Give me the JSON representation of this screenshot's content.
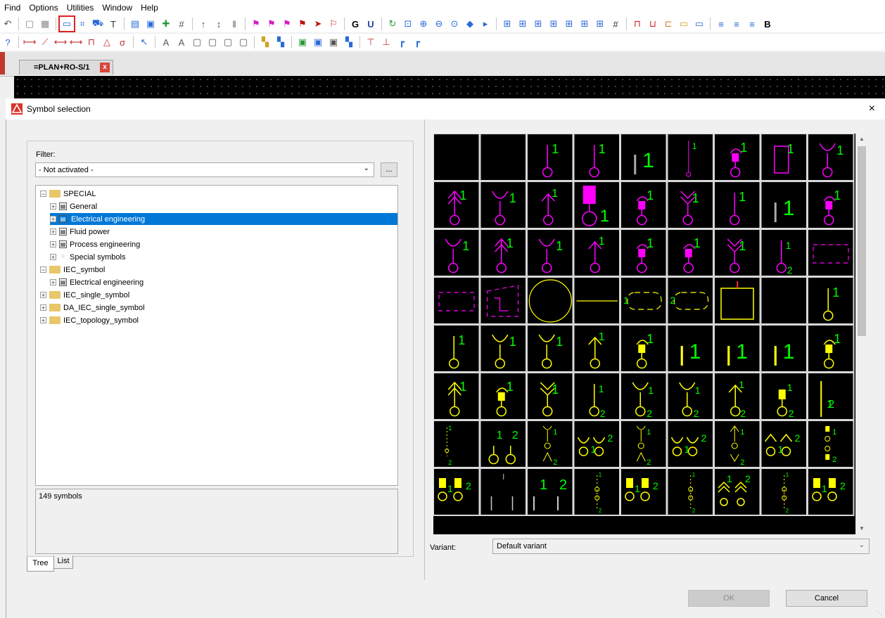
{
  "menu": [
    "Find",
    "Options",
    "Utilities",
    "Window",
    "Help"
  ],
  "toolbar_row1_icons": [
    "undo-icon",
    "page-icon",
    "table-icon",
    "insert-symbol-icon",
    "macro-icon",
    "cart-icon",
    "text-icon",
    "navigator-icon",
    "window-icon",
    "puzzle-icon",
    "numbering-icon",
    "number-up-icon",
    "number-sort-icon",
    "bar-icon",
    "flag-magenta-icon",
    "flag-purple-icon",
    "flag-pink-icon",
    "flag-red-icon",
    "arrow-red-icon",
    "flag-x-icon",
    "g-icon",
    "u-icon",
    "refresh-icon",
    "zoom-window-icon",
    "zoom-in-icon",
    "zoom-out-icon",
    "zoom-fit-icon",
    "back-icon",
    "forward-icon",
    "grid-a-icon",
    "grid-b-icon",
    "grid-c-icon",
    "grid-d-icon",
    "grid-e-icon",
    "grid-f-icon",
    "grid-g-icon",
    "grid-h-icon",
    "cable-icon",
    "cable2-icon",
    "plug-icon",
    "device-icon",
    "box-icon",
    "format-a-icon",
    "format-b-icon",
    "format-c-icon",
    "bold-icon"
  ],
  "toolbar_row2_icons": [
    "help-icon",
    "line-icon",
    "pen-icon",
    "dim-icon",
    "dim2-icon",
    "rect-icon",
    "polygon-icon",
    "arc-icon",
    "pointer-icon",
    "text-a-icon",
    "text-b-icon",
    "rect-a-icon",
    "rect-b-icon",
    "rect-c-icon",
    "rect-d-icon",
    "layer-a-icon",
    "layer-b-icon",
    "layer-c-icon",
    "layer-d-icon",
    "layer-e-icon",
    "layer-f-icon",
    "cross-icon",
    "cross2-icon",
    "corner-icon",
    "corner2-icon"
  ],
  "doc_tab": {
    "label": "=PLAN+RO-S/1",
    "close": "x"
  },
  "dialog": {
    "title": "Symbol selection",
    "close": "×"
  },
  "filter": {
    "label": "Filter:",
    "value": "- Not activated -",
    "button": "..."
  },
  "tree": [
    {
      "label": "SPECIAL",
      "level": 0,
      "expander": "⊟",
      "icon": "folder"
    },
    {
      "label": "General",
      "level": 1,
      "expander": "⊞",
      "icon": "group"
    },
    {
      "label": "Electrical engineering",
      "level": 1,
      "expander": "⊞",
      "icon": "group",
      "selected": true
    },
    {
      "label": "Fluid power",
      "level": 1,
      "expander": "⊞",
      "icon": "group"
    },
    {
      "label": "Process engineering",
      "level": 1,
      "expander": "⊞",
      "icon": "group"
    },
    {
      "label": "Special symbols",
      "level": 1,
      "expander": "⊞",
      "icon": "special"
    },
    {
      "label": "IEC_symbol",
      "level": 0,
      "expander": "⊟",
      "icon": "folder"
    },
    {
      "label": "Electrical engineering",
      "level": 1,
      "expander": "⊞",
      "icon": "group"
    },
    {
      "label": "IEC_single_symbol",
      "level": 0,
      "expander": "⊞",
      "icon": "folder"
    },
    {
      "label": "DA_IEC_single_symbol",
      "level": 0,
      "expander": "⊞",
      "icon": "folder"
    },
    {
      "label": "IEC_topology_symbol",
      "level": 0,
      "expander": "⊞",
      "icon": "folder"
    }
  ],
  "symbol_count": "149 symbols",
  "bottom_tabs": {
    "tree": "Tree",
    "list": "List"
  },
  "variant": {
    "label": "Variant:",
    "value": "Default variant"
  },
  "buttons": {
    "ok": "OK",
    "cancel": "Cancel"
  },
  "colors": {
    "magenta": "#ff00ff",
    "yellow": "#ffff00",
    "green": "#00ff00",
    "selection": "#0078d7"
  },
  "symbol_grid": [
    [
      {
        "c": "blank"
      },
      {
        "c": "blank"
      },
      {
        "c": "m",
        "t": "pin",
        "n": [
          "1"
        ]
      },
      {
        "c": "m",
        "t": "pin",
        "n": [
          "1"
        ]
      },
      {
        "c": "m",
        "t": "bar",
        "n": [
          "1"
        ]
      },
      {
        "c": "m",
        "t": "thin",
        "n": [
          "1"
        ]
      },
      {
        "c": "m",
        "t": "plug",
        "n": [
          "1"
        ]
      },
      {
        "c": "m",
        "t": "box",
        "n": [
          "1"
        ]
      },
      {
        "c": "m",
        "t": "fork",
        "n": [
          "1"
        ]
      }
    ],
    [
      {
        "c": "m",
        "t": "dblarrow",
        "n": [
          "1"
        ]
      },
      {
        "c": "m",
        "t": "fork",
        "n": [
          "1"
        ]
      },
      {
        "c": "m",
        "t": "arrow",
        "n": [
          "1"
        ]
      },
      {
        "c": "m",
        "t": "bigplug",
        "n": [
          "1"
        ]
      },
      {
        "c": "m",
        "t": "plug",
        "n": [
          "1"
        ]
      },
      {
        "c": "m",
        "t": "vfork",
        "n": [
          "1"
        ]
      },
      {
        "c": "m",
        "t": "pin",
        "n": [
          "1"
        ]
      },
      {
        "c": "m",
        "t": "bar",
        "n": [
          "1"
        ]
      },
      {
        "c": "m",
        "t": "plug",
        "n": [
          "1"
        ]
      }
    ],
    [
      {
        "c": "m",
        "t": "fork",
        "n": [
          "1"
        ]
      },
      {
        "c": "m",
        "t": "dblarrow",
        "n": [
          "1"
        ]
      },
      {
        "c": "m",
        "t": "fork",
        "n": [
          "1"
        ]
      },
      {
        "c": "m",
        "t": "arrow",
        "n": [
          "1"
        ]
      },
      {
        "c": "m",
        "t": "plug",
        "n": [
          "1"
        ]
      },
      {
        "c": "m",
        "t": "plug",
        "n": [
          "1"
        ]
      },
      {
        "c": "m",
        "t": "vfork",
        "n": [
          "1"
        ]
      },
      {
        "c": "m",
        "t": "pin2",
        "n": [
          "1",
          "2"
        ]
      },
      {
        "c": "m",
        "t": "dashbox",
        "n": []
      }
    ],
    [
      {
        "c": "m",
        "t": "dashbox",
        "n": []
      },
      {
        "c": "m",
        "t": "dashbox2",
        "n": []
      },
      {
        "c": "y",
        "t": "circle",
        "n": []
      },
      {
        "c": "y",
        "t": "hline",
        "n": []
      },
      {
        "c": "y",
        "t": "dashround",
        "n": [
          "1"
        ]
      },
      {
        "c": "y",
        "t": "dashround",
        "n": [
          "2"
        ]
      },
      {
        "c": "y",
        "t": "square",
        "n": []
      },
      {
        "c": "blank"
      },
      {
        "c": "y",
        "t": "pin",
        "n": [
          "1"
        ]
      }
    ],
    [
      {
        "c": "y",
        "t": "pin",
        "n": [
          "1"
        ]
      },
      {
        "c": "y",
        "t": "fork",
        "n": [
          "1"
        ]
      },
      {
        "c": "y",
        "t": "fork",
        "n": [
          "1"
        ]
      },
      {
        "c": "y",
        "t": "arrow",
        "n": [
          "1"
        ]
      },
      {
        "c": "y",
        "t": "plug",
        "n": [
          "1"
        ]
      },
      {
        "c": "y",
        "t": "bar",
        "n": [
          "1"
        ]
      },
      {
        "c": "y",
        "t": "bar",
        "n": [
          "1"
        ]
      },
      {
        "c": "y",
        "t": "bar",
        "n": [
          "1"
        ]
      },
      {
        "c": "y",
        "t": "plug",
        "n": [
          "1"
        ]
      }
    ],
    [
      {
        "c": "y",
        "t": "dblarrow",
        "n": [
          "1"
        ]
      },
      {
        "c": "y",
        "t": "plug",
        "n": [
          "1"
        ]
      },
      {
        "c": "y",
        "t": "vfork",
        "n": [
          "1"
        ]
      },
      {
        "c": "y",
        "t": "pin2",
        "n": [
          "1",
          "2"
        ]
      },
      {
        "c": "y",
        "t": "fork2",
        "n": [
          "1",
          "2"
        ]
      },
      {
        "c": "y",
        "t": "fork2",
        "n": [
          "1",
          "2"
        ]
      },
      {
        "c": "y",
        "t": "arrow2",
        "n": [
          "1",
          "2"
        ]
      },
      {
        "c": "y",
        "t": "plug2",
        "n": [
          "1",
          "2"
        ]
      },
      {
        "c": "y",
        "t": "line2",
        "n": [
          "1",
          "2"
        ]
      }
    ],
    [
      {
        "c": "y",
        "t": "mini2",
        "n": [
          "1",
          "2"
        ]
      },
      {
        "c": "y",
        "t": "twopin",
        "n": [
          "1",
          "2"
        ]
      },
      {
        "c": "y",
        "t": "forkmini",
        "n": [
          "1",
          "2"
        ]
      },
      {
        "c": "y",
        "t": "twofork",
        "n": [
          "1",
          "2"
        ]
      },
      {
        "c": "y",
        "t": "forkmini",
        "n": [
          "1",
          "2"
        ]
      },
      {
        "c": "y",
        "t": "twofork",
        "n": [
          "1",
          "2"
        ]
      },
      {
        "c": "y",
        "t": "arrowmini",
        "n": [
          "1",
          "2"
        ]
      },
      {
        "c": "y",
        "t": "twoarrow",
        "n": [
          "1",
          "2"
        ]
      },
      {
        "c": "y",
        "t": "plugmini",
        "n": [
          "1",
          "2"
        ]
      }
    ],
    [
      {
        "c": "y",
        "t": "twoplug",
        "n": [
          "1",
          "2"
        ]
      },
      {
        "c": "y",
        "t": "thin2",
        "n": [
          "1",
          "2"
        ]
      },
      {
        "c": "y",
        "t": "twobar",
        "n": [
          "1",
          "2"
        ]
      },
      {
        "c": "y",
        "t": "tiny",
        "n": [
          "1",
          "2"
        ]
      },
      {
        "c": "y",
        "t": "twoplug",
        "n": [
          "1",
          "2"
        ]
      },
      {
        "c": "y",
        "t": "tiny",
        "n": [
          "1",
          "2"
        ]
      },
      {
        "c": "y",
        "t": "twodblarrow",
        "n": [
          "1",
          "2"
        ]
      },
      {
        "c": "y",
        "t": "tiny",
        "n": [
          "1",
          "2"
        ]
      },
      {
        "c": "y",
        "t": "twoplug",
        "n": [
          "1",
          "2"
        ]
      }
    ]
  ]
}
